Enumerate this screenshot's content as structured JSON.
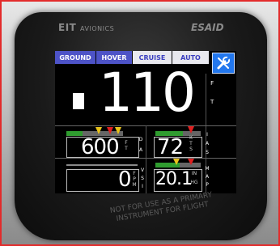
{
  "device": {
    "brand": "EIT",
    "brand_suffix": "AVIONICS",
    "model": "ESAID"
  },
  "modes": [
    {
      "label": "GROUND",
      "active": true
    },
    {
      "label": "HOVER",
      "active": true
    },
    {
      "label": "CRUISE",
      "active": false
    },
    {
      "label": "AUTO",
      "active": false
    }
  ],
  "altitude": {
    "value": "110",
    "unit_letters": [
      "F",
      "T"
    ]
  },
  "density_altitude": {
    "value": "600",
    "unit_letters": [
      "F",
      "T"
    ],
    "label_letters": [
      "D",
      "A"
    ]
  },
  "airspeed": {
    "value": "72",
    "unit_letters": [
      "K",
      "T",
      "S"
    ],
    "label_letters": [
      "I",
      "A",
      "S"
    ]
  },
  "vsi": {
    "value": "0",
    "unit_letters": [
      "F",
      "P",
      "M"
    ],
    "label_letters": [
      "V",
      "S",
      "I"
    ]
  },
  "map": {
    "value": "20.1",
    "unit_letters": [
      "I",
      "N",
      "H",
      "G"
    ],
    "label_letters": [
      "M",
      "A",
      "P"
    ]
  },
  "icons": {
    "settings": "wrench-icon"
  },
  "colors": {
    "mode_active_bg": "#4d53c7",
    "mode_inactive_bg": "#e8e8ee",
    "settings_bg": "#2277ee",
    "gauge_green": "#2f9c2f",
    "marker_red": "#e02020",
    "marker_yellow": "#e8c21a",
    "border_red": "#e32b2b"
  },
  "warning": {
    "line1": "NOT FOR USE AS A PRIMARY",
    "line2": "INSTRUMENT FOR FLIGHT"
  }
}
